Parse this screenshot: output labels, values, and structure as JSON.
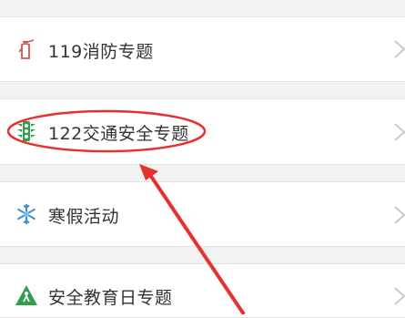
{
  "menu": {
    "items": [
      {
        "label": "119消防专题",
        "icon": "fire-extinguisher-icon"
      },
      {
        "label": "122交通安全专题",
        "icon": "traffic-light-icon"
      },
      {
        "label": "寒假活动",
        "icon": "snowflake-icon"
      },
      {
        "label": "安全教育日专题",
        "icon": "safety-warning-icon"
      }
    ]
  },
  "colors": {
    "annotation": "#e8302c",
    "row_bg": "#ffffff",
    "gap_bg": "#f2f2f2",
    "text": "#333333",
    "chevron": "#c4c4c4"
  }
}
